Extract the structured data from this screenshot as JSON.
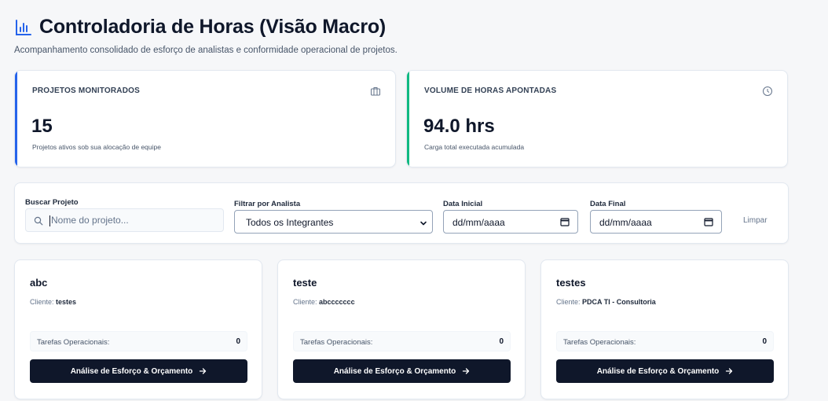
{
  "header": {
    "title": "Controladoria de Horas (Visão Macro)",
    "subtitle": "Acompanhamento consolidado de esforço de analistas e conformidade operacional de projetos."
  },
  "kpis": [
    {
      "label": "PROJETOS MONITORADOS",
      "value": "15",
      "caption": "Projetos ativos sob sua alocação de equipe",
      "accent": "#2563eb",
      "icon": "briefcase-icon"
    },
    {
      "label": "VOLUME DE HORAS APONTADAS",
      "value": "94.0 hrs",
      "caption": "Carga total executada acumulada",
      "accent": "#10b981",
      "icon": "clock-icon"
    }
  ],
  "filters": {
    "search_label": "Buscar Projeto",
    "search_placeholder": "Nome do projeto...",
    "analyst_label": "Filtrar por Analista",
    "analyst_value": "Todos os Integrantes",
    "start_label": "Data Inicial",
    "start_value": "dd/mm/aaaa",
    "end_label": "Data Final",
    "end_value": "dd/mm/aaaa",
    "clear_label": "Limpar"
  },
  "projects": [
    {
      "name": "abc",
      "client_label": "Cliente:",
      "client": "testes",
      "tasks_label": "Tarefas Operacionais:",
      "tasks": "0",
      "button": "Análise de Esforço & Orçamento"
    },
    {
      "name": "teste",
      "client_label": "Cliente:",
      "client": "abccccccc",
      "tasks_label": "Tarefas Operacionais:",
      "tasks": "0",
      "button": "Análise de Esforço & Orçamento"
    },
    {
      "name": "testes",
      "client_label": "Cliente:",
      "client": "PDCA TI - Consultoria",
      "tasks_label": "Tarefas Operacionais:",
      "tasks": "0",
      "button": "Análise de Esforço & Orçamento"
    }
  ],
  "colors": {
    "primary": "#0f172a",
    "accent_blue": "#2563eb",
    "accent_green": "#10b981"
  }
}
